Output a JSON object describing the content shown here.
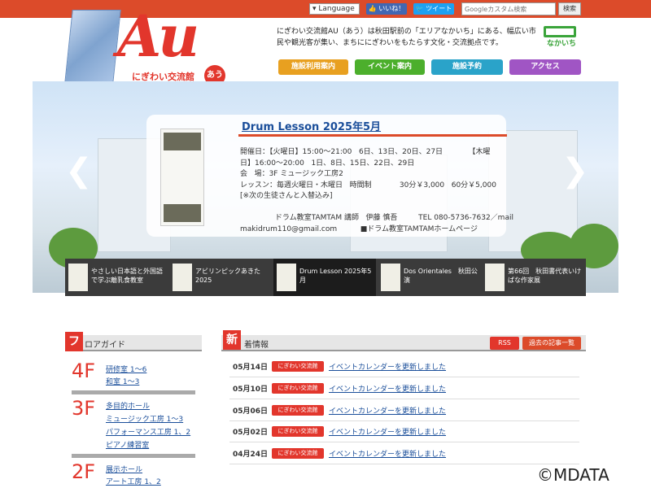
{
  "topbar": {
    "language": "▾ Language",
    "like": "👍 いいね！",
    "tweet": "🐦 ツイート",
    "search_placeholder": "Googleカスタム検索",
    "search_button": "検索"
  },
  "logo": {
    "main": "Au",
    "sub": "にぎわい交流館",
    "badge": "あう"
  },
  "intro": "にぎわい交流館AU（あう）は秋田駅前の「エリアなかいち」にある、幅広い市民や観光客が集い、まちににぎわいをもたらす文化・交流拠点です。",
  "nakaichi_label": "なかいち",
  "nav": [
    {
      "label": "施設利用案内",
      "color": "#e8a020"
    },
    {
      "label": "イベント案内",
      "color": "#4caf2c"
    },
    {
      "label": "施設予約",
      "color": "#2aa3c9"
    },
    {
      "label": "アクセス",
      "color": "#a055c4"
    }
  ],
  "featured": {
    "title": "Drum Lesson 2025年5月",
    "body": "開催日：【火曜日】15:00～21:00   6日、13日、20日、27日           【木曜\n日】16:00～20:00   1日、8日、15日、22日、29日\n会   場：3F ミュージック工房2\nレッスン：毎週火曜日・木曜日   時間制            30分￥3,000   60分￥5,000\n[※次の生徒さんと入替込み]\n\n               ドラム教室TAMTAM 講師   伊藤 慎吾         TEL 080-5736-7632／mail\nmakidrum110@gmail.com          ■ドラム教室TAMTAMホームページ"
  },
  "strip": [
    {
      "label": "やさしい日本語と外国語で学ぶ離乳食教室"
    },
    {
      "label": "アビリンピックあきた2025"
    },
    {
      "label": "Drum Lesson 2025年5月"
    },
    {
      "label": "Dos Orientales　秋田公演"
    },
    {
      "label": "第66回　秋田書代表いけばな作家展"
    }
  ],
  "floor": {
    "heading_badge": "フ",
    "heading": "ロアガイド",
    "floors": [
      {
        "num": "4F",
        "links": [
          "研修室 1～6",
          "和室 1～3"
        ]
      },
      {
        "num": "3F",
        "links": [
          "多目的ホール",
          "ミュージック工房 1～3",
          "パフォーマンス工房 1、2",
          "ピアノ練習室"
        ]
      },
      {
        "num": "2F",
        "links": [
          "展示ホール",
          "アート工房 1、2"
        ]
      }
    ]
  },
  "news": {
    "heading_badge": "新",
    "heading": "着情報",
    "rss": "RSS",
    "past": "過去の記事一覧",
    "items": [
      {
        "date": "05月14日",
        "tag": "にぎわい交流館",
        "text": "イベントカレンダーを更新しました"
      },
      {
        "date": "05月10日",
        "tag": "にぎわい交流館",
        "text": "イベントカレンダーを更新しました"
      },
      {
        "date": "05月06日",
        "tag": "にぎわい交流館",
        "text": "イベントカレンダーを更新しました"
      },
      {
        "date": "05月02日",
        "tag": "にぎわい交流館",
        "text": "イベントカレンダーを更新しました"
      },
      {
        "date": "04月24日",
        "tag": "にぎわい交流館",
        "text": "イベントカレンダーを更新しました"
      }
    ]
  },
  "copyright": "©MDATA"
}
